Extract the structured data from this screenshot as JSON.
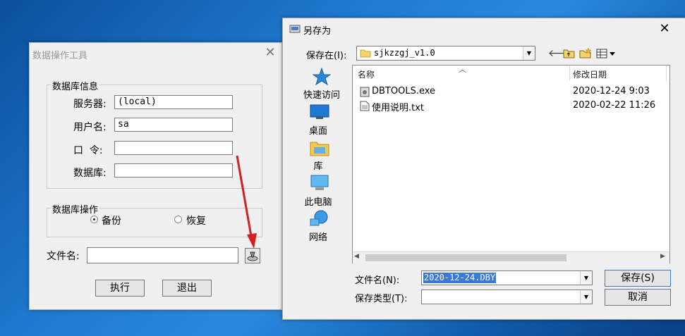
{
  "tool_dialog": {
    "title": "数据操作工具",
    "db_info": {
      "legend": "数据库信息",
      "server_label": "服务器:",
      "server_value": "(local)",
      "user_label": "用户名:",
      "user_value": "sa",
      "password_label": "口  令:",
      "password_value": "",
      "database_label": "数据库:",
      "database_value": ""
    },
    "db_ops": {
      "legend": "数据库操作",
      "backup_label": "备份",
      "restore_label": "恢复",
      "selected": "backup"
    },
    "file": {
      "label": "文件名:",
      "value": ""
    },
    "execute_label": "执行",
    "exit_label": "退出"
  },
  "save_dialog": {
    "title": "另存为",
    "save_in_label": "保存在(I):",
    "save_in_value": "sjkzzgj_v1.0",
    "places": [
      {
        "label": "快速访问",
        "icon": "star-icon"
      },
      {
        "label": "桌面",
        "icon": "desktop-icon"
      },
      {
        "label": "库",
        "icon": "library-icon"
      },
      {
        "label": "此电脑",
        "icon": "computer-icon"
      },
      {
        "label": "网络",
        "icon": "network-icon"
      }
    ],
    "columns": {
      "name": "名称",
      "date": "修改日期"
    },
    "files": [
      {
        "name": "DBTOOLS.exe",
        "date": "2020-12-24 9:03"
      },
      {
        "name": "使用说明.txt",
        "date": "2020-02-22 11:26"
      }
    ],
    "filename_label": "文件名(N):",
    "filename_value": "2020-12-24.DBY",
    "filetype_label": "保存类型(T):",
    "filetype_value": "",
    "save_label": "保存(S)",
    "cancel_label": "取消"
  },
  "colors": {
    "arrow": "#d42020",
    "selection": "#3b78d8"
  }
}
